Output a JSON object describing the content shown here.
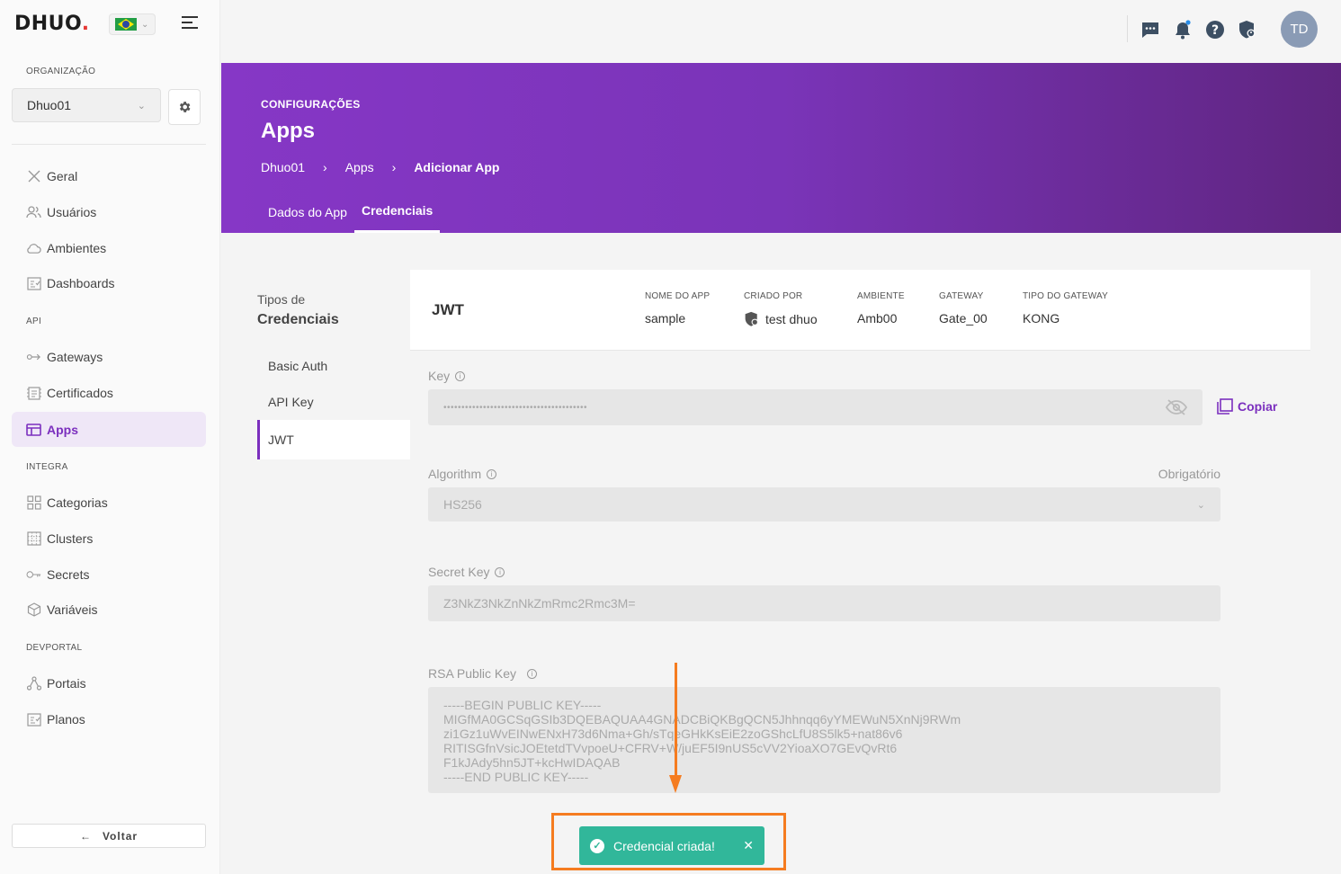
{
  "sidebar": {
    "logo": "DHUO",
    "org_section": "ORGANIZAÇÃO",
    "org_value": "Dhuo01",
    "items_top": [
      {
        "label": "Geral",
        "icon": "tools-icon"
      },
      {
        "label": "Usuários",
        "icon": "users-icon"
      },
      {
        "label": "Ambientes",
        "icon": "cloud-icon"
      },
      {
        "label": "Dashboards",
        "icon": "dashboard-icon"
      }
    ],
    "api_section": "API",
    "items_api": [
      {
        "label": "Gateways",
        "icon": "gateway-icon"
      },
      {
        "label": "Certificados",
        "icon": "certificate-icon"
      },
      {
        "label": "Apps",
        "icon": "apps-icon",
        "active": true
      }
    ],
    "integra_section": "INTEGRA",
    "items_integra": [
      {
        "label": "Categorias",
        "icon": "categories-icon"
      },
      {
        "label": "Clusters",
        "icon": "clusters-icon"
      },
      {
        "label": "Secrets",
        "icon": "key-icon"
      },
      {
        "label": "Variáveis",
        "icon": "variables-icon"
      }
    ],
    "devportal_section": "DEVPORTAL",
    "items_devportal": [
      {
        "label": "Portais",
        "icon": "portals-icon"
      },
      {
        "label": "Planos",
        "icon": "plans-icon"
      }
    ],
    "back_label": "Voltar"
  },
  "topbar": {
    "avatar_initials": "TD",
    "icons": [
      "chat-icon",
      "bell-icon",
      "help-icon",
      "shield-icon"
    ]
  },
  "header": {
    "eyebrow": "CONFIGURAÇÕES",
    "title": "Apps",
    "breadcrumb": [
      "Dhuo01",
      "Apps",
      "Adicionar App"
    ],
    "tabs": [
      {
        "label": "Dados do App",
        "active": false
      },
      {
        "label": "Credenciais",
        "active": true
      }
    ]
  },
  "credentials": {
    "title_line1": "Tipos de",
    "title_line2": "Credenciais",
    "types": [
      {
        "label": "Basic Auth",
        "active": false
      },
      {
        "label": "API Key",
        "active": false
      },
      {
        "label": "JWT",
        "active": true
      }
    ]
  },
  "panel": {
    "title": "JWT",
    "meta": [
      {
        "label": "NOME DO APP",
        "value": "sample"
      },
      {
        "label": "CRIADO POR",
        "value": "test dhuo"
      },
      {
        "label": "AMBIENTE",
        "value": "Amb00"
      },
      {
        "label": "GATEWAY",
        "value": "Gate_00"
      },
      {
        "label": "TIPO DO GATEWAY",
        "value": "KONG"
      }
    ],
    "key_label": "Key",
    "key_value": "••••••••••••••••••••••••••••••••••••••••",
    "copy_label": "Copiar",
    "algorithm_label": "Algorithm",
    "algorithm_required": "Obrigatório",
    "algorithm_value": "HS256",
    "secret_label": "Secret Key",
    "secret_value": "Z3NkZ3NkZnNkZmRmc2Rmc3M=",
    "rsa_label": "RSA Public Key",
    "rsa_value": "-----BEGIN PUBLIC KEY-----\nMIGfMA0GCSqGSIb3DQEBAQUAA4GNADCBiQKBgQCN5Jhhnqq6yYMEWuN5XnNj9RWm\nzi1Gz1uWvEINwENxH73d6Nma+Gh/sTqeGHkKsEiE2zoGShcLfU8S5lk5+nat86v6\nRITISGfnVsicJOEtetdTVvpoeU+CFRV+W/juEF5I9nUS5cVV2YioaXO7GEvQvRt6\nF1kJAdy5hn5JT+kcHwIDAQAB\n-----END PUBLIC KEY-----"
  },
  "toast": {
    "message": "Credencial criada!"
  },
  "colors": {
    "accent": "#7b2fbe",
    "toast": "#31b79a",
    "annotation": "#f57c20"
  }
}
